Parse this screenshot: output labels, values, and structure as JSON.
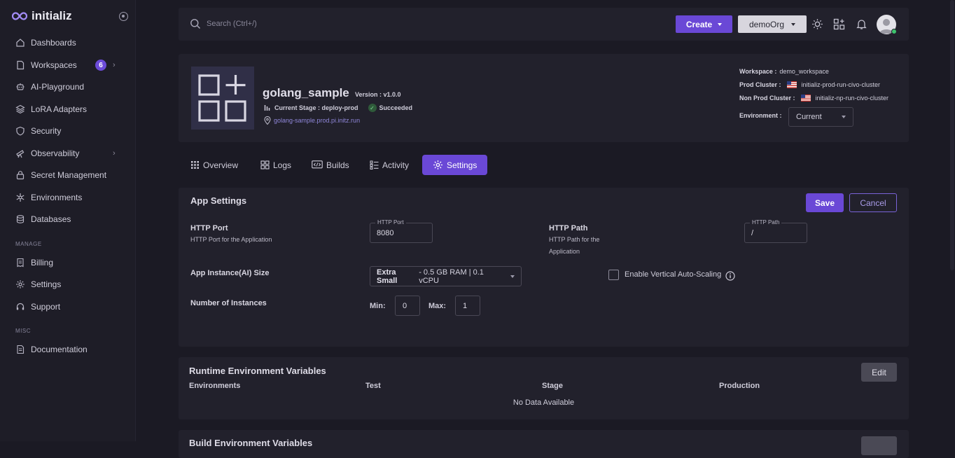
{
  "brand": {
    "name": "initializ"
  },
  "sidebar": {
    "items": [
      {
        "label": "Dashboards",
        "icon": "home-icon"
      },
      {
        "label": "Workspaces",
        "icon": "file-icon",
        "badge": "6"
      },
      {
        "label": "AI-Playground",
        "icon": "robot-icon"
      },
      {
        "label": "LoRA Adapters",
        "icon": "layers-icon"
      },
      {
        "label": "Security",
        "icon": "shield-icon"
      },
      {
        "label": "Observability",
        "icon": "telescope-icon"
      },
      {
        "label": "Secret Management",
        "icon": "lock-icon"
      },
      {
        "label": "Environments",
        "icon": "snowflake-icon"
      },
      {
        "label": "Databases",
        "icon": "database-icon"
      }
    ],
    "manage_label": "MANAGE",
    "manage_items": [
      {
        "label": "Billing",
        "icon": "receipt-icon"
      },
      {
        "label": "Settings",
        "icon": "gear-icon"
      },
      {
        "label": "Support",
        "icon": "headset-icon"
      }
    ],
    "misc_label": "MISC",
    "misc_items": [
      {
        "label": "Documentation",
        "icon": "document-icon"
      }
    ]
  },
  "topbar": {
    "search_placeholder": "Search (Ctrl+/)",
    "create_label": "Create",
    "org_label": "demoOrg"
  },
  "app": {
    "name": "golang_sample",
    "version": "Version : v1.0.0",
    "stage": "Current Stage : deploy-prod",
    "status": "Succeeded",
    "url": "golang-sample.prod.pi.initz.run",
    "workspace_label": "Workspace :",
    "workspace_value": "demo_workspace",
    "prod_cluster_label": "Prod Cluster :",
    "prod_cluster_value": "initializ-prod-run-civo-cluster",
    "nonprod_cluster_label": "Non Prod Cluster :",
    "nonprod_cluster_value": "initializ-np-run-civo-cluster",
    "environment_label": "Environment :",
    "environment_value": "Current"
  },
  "tabs": [
    {
      "label": "Overview",
      "icon": "grid-icon"
    },
    {
      "label": "Logs",
      "icon": "logs-icon"
    },
    {
      "label": "Builds",
      "icon": "code-icon"
    },
    {
      "label": "Activity",
      "icon": "activity-icon"
    },
    {
      "label": "Settings",
      "icon": "gear-icon",
      "active": true
    }
  ],
  "app_settings": {
    "title": "App Settings",
    "save_label": "Save",
    "cancel_label": "Cancel",
    "http_port_label": "HTTP Port",
    "http_port_desc": "HTTP Port for the Application",
    "http_port_legend": "HTTP Port",
    "http_port_value": "8080",
    "http_path_label": "HTTP Path",
    "http_path_desc_1": "HTTP Path for the",
    "http_path_desc_2": "Application",
    "http_path_legend": "HTTP Path",
    "http_path_value": "/",
    "size_label": "App Instance(AI) Size",
    "size_value_bold": "Extra Small",
    "size_value_rest": " - 0.5 GB RAM | 0.1 vCPU",
    "autoscale_label": "Enable Vertical Auto-Scaling",
    "instances_label": "Number of Instances",
    "min_label": "Min:",
    "min_value": "0",
    "max_label": "Max:",
    "max_value": "1"
  },
  "runtime_env": {
    "title": "Runtime Environment Variables",
    "edit_label": "Edit",
    "columns": [
      "Environments",
      "Test",
      "Stage",
      "Production"
    ],
    "empty": "No Data Available"
  },
  "build_env": {
    "title": "Build Environment Variables"
  },
  "colors": {
    "accent": "#6a48d6",
    "background": "#1b1a24",
    "card": "#22212c",
    "success": "#3ec46d"
  }
}
